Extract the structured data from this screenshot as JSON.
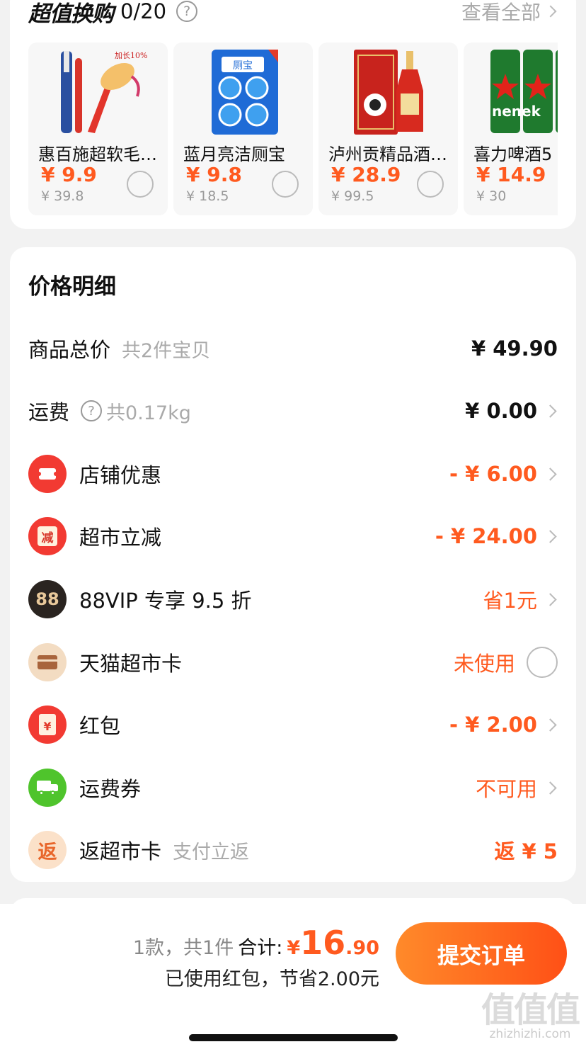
{
  "exchange": {
    "title": "超值换购",
    "count": "0/20",
    "help_icon": "?",
    "view_all": "查看全部",
    "products": [
      {
        "name": "惠百施超软毛…",
        "price": "¥ 9.9",
        "original_price": "¥ 39.8",
        "image": "toothbrush"
      },
      {
        "name": "蓝月亮洁厕宝",
        "price": "¥ 9.8",
        "original_price": "¥ 18.5",
        "image": "toilet-cleaner"
      },
      {
        "name": "泸州贡精品酒…",
        "price": "¥ 28.9",
        "original_price": "¥ 99.5",
        "image": "baijiu"
      },
      {
        "name": "喜力啤酒5",
        "price": "¥ 14.9",
        "original_price": "¥ 30",
        "image": "beer-cans"
      }
    ]
  },
  "price_detail": {
    "title": "价格明细",
    "rows": [
      {
        "label": "商品总价",
        "sub": "共2件宝贝",
        "value": "¥ 49.90"
      },
      {
        "label": "运费",
        "sub": "共0.17kg",
        "value": "¥ 0.00"
      },
      {
        "label": "店铺优惠",
        "value": "- ¥ 6.00",
        "icon": "coupon-icon"
      },
      {
        "label": "超市立减",
        "value": "- ¥ 24.00",
        "icon": "discount-icon",
        "icon_text": "减"
      },
      {
        "label": "88VIP 专享 9.5 折",
        "value": "省1元",
        "icon": "vip88-icon",
        "icon_text": "88"
      },
      {
        "label": "天猫超市卡",
        "value": "未使用",
        "icon": "card-icon"
      },
      {
        "label": "红包",
        "value": "- ¥ 2.00",
        "icon": "red-packet-icon",
        "icon_text": "¥"
      },
      {
        "label": "运费券",
        "value": "不可用",
        "icon": "truck-icon"
      },
      {
        "label": "返超市卡",
        "sub": "支付立返",
        "value": "返 ¥ 5",
        "icon": "rebate-icon",
        "icon_text": "返"
      }
    ]
  },
  "footer": {
    "count": "1款，共1件",
    "total_label": "合计:",
    "currency": "¥",
    "total_int": "16",
    "total_dec": ".90",
    "savings": "已使用红包，节省2.00元",
    "submit": "提交订单"
  },
  "watermark": {
    "logo": "值值值",
    "url": "zhizhizhi.com"
  },
  "colors": {
    "accent": "#ff5a1f",
    "button_start": "#ff8a2a",
    "button_end": "#ff5016"
  }
}
